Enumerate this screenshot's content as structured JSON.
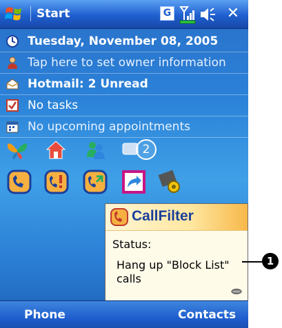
{
  "titlebar": {
    "title": "Start",
    "g_indicator": "G",
    "close_glyph": "✕"
  },
  "today": {
    "date": "Tuesday, November 08, 2005",
    "owner": "Tap here to set owner information",
    "mail": "Hotmail: 2 Unread",
    "tasks": "No tasks",
    "appointments": "No upcoming appointments"
  },
  "quick_icons": {
    "items": [
      "msn-butterfly-icon",
      "home-icon",
      "messenger-buddies-icon",
      "notification-bubble-icon"
    ],
    "notification_count": "2"
  },
  "app_icons": [
    "callfilter-phone-icon",
    "callfilter-warning-icon",
    "callfilter-arrow-icon",
    "callfilter-share-icon",
    "gear-chip-icon"
  ],
  "popup": {
    "title": "CallFilter",
    "status_label": "Status:",
    "message": "Hang up \"Block List\" calls"
  },
  "softkeys": {
    "left": "Phone",
    "right": "Contacts"
  },
  "callout": {
    "number": "1"
  },
  "colors": {
    "titlebar": "#1f5fcf",
    "today_background": "#2b82d8",
    "popup_background": "#fffbe9",
    "popup_title": "#1a3f9a"
  }
}
